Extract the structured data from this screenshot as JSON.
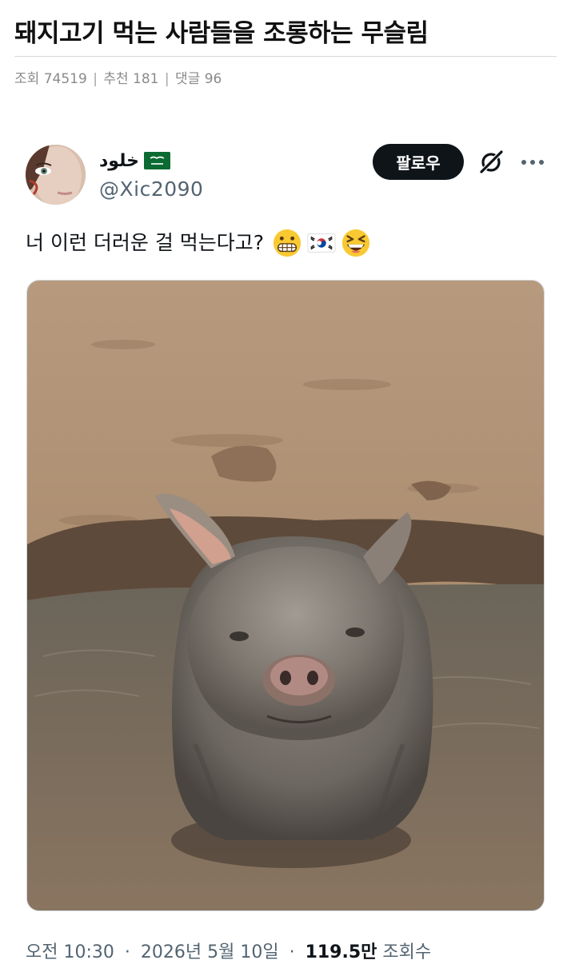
{
  "post": {
    "title": "돼지고기 먹는 사람들을 조롱하는 무슬림",
    "views_label": "조회",
    "views": "74519",
    "recommend_label": "추천",
    "recommend": "181",
    "comments_label": "댓글",
    "comments": "96",
    "separator": "|"
  },
  "tweet": {
    "display_name": "خلود",
    "flag_icon": "saudi-arabia-flag-icon",
    "handle": "@Xic2090",
    "follow_label": "팔로우",
    "grok_icon": "grok-icon",
    "more_icon": "more-horizontal-icon",
    "text": "너 이런 더러운 걸 먹는다고?",
    "emojis": [
      "grimacing-face-emoji",
      "south-korea-flag-emoji",
      "grinning-squinting-face-emoji"
    ],
    "image_alt": "pig-in-mud-photo",
    "time": "오전 10:30",
    "dot": "·",
    "date": "2026년 5월 10일",
    "views_count": "119.5만",
    "views_label": "조회수"
  },
  "colors": {
    "follow_bg": "#0f1419",
    "secondary_text": "#536471",
    "meta_text": "#8a8a8a",
    "flag_green": "#0b6b33"
  }
}
